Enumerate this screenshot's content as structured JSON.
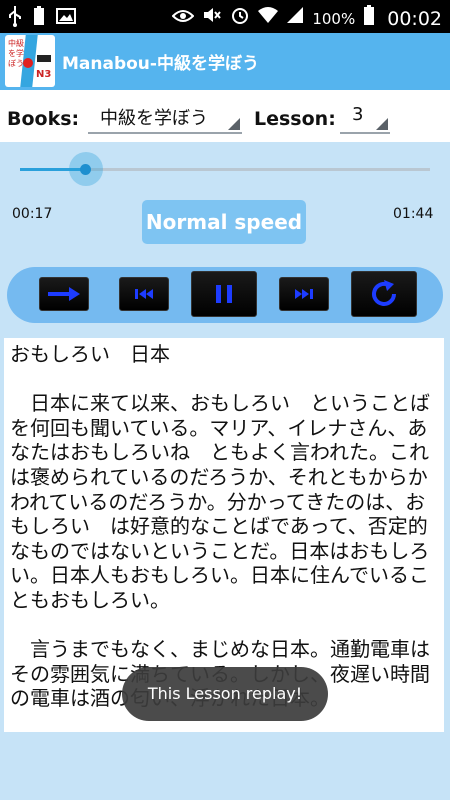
{
  "status_bar": {
    "battery_percent": "100%",
    "time": "00:02",
    "icons": [
      "usb-icon",
      "battery-full-icon",
      "image-icon",
      "eye-icon",
      "mute-icon",
      "alarm-icon",
      "wifi-icon",
      "signal-icon",
      "battery-icon"
    ]
  },
  "app": {
    "title": "Manabou-中級を学ぼう",
    "icon": "app-logo-icon",
    "icon_badge": "N3"
  },
  "selectors": {
    "books_label": "Books:",
    "books_value": "中級を学ぼう",
    "lesson_label": "Lesson:",
    "lesson_value": "3"
  },
  "player": {
    "progress": 0.16,
    "elapsed": "00:17",
    "duration": "01:44",
    "speed_label": "Normal speed",
    "controls": [
      "next-arrow-icon",
      "skip-previous-icon",
      "pause-icon",
      "skip-next-icon",
      "replay-icon"
    ],
    "accent_color": "#1e8fcf"
  },
  "lesson": {
    "title": "おもしろい　日本",
    "paragraphs": [
      "　日本に来て以来、おもしろい　ということばを何回も聞いている。マリア、イレナさん、あなたはおもしろいね　ともよく言われた。これは褒められているのだろうか、それともからかわれているのだろうか。分かってきたのは、おもしろい　は好意的なことばであって、否定的なものではないということだ。日本はおもしろい。日本人もおもしろい。日本に住んでいることもおもしろい。",
      "　言うまでもなく、まじめな日本。通勤電車はその雰囲気に満ちている。しかし、夜遅い時間の電車は酒の匂い、浮かれた日本。"
    ]
  },
  "toast": {
    "message": "This Lesson replay!"
  },
  "colors": {
    "action_bar": "#55b4ee",
    "background": "#c6e3f7",
    "controls_bar": "#75baf0"
  }
}
